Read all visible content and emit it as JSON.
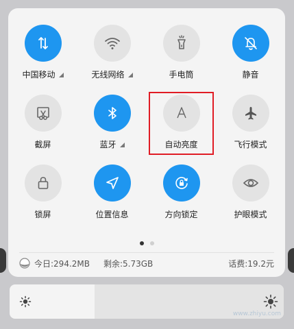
{
  "tiles": [
    {
      "label": "中国移动",
      "icon": "data-transfer-icon",
      "active": true,
      "dropdown": true
    },
    {
      "label": "无线网络",
      "icon": "wifi-icon",
      "active": false,
      "dropdown": true
    },
    {
      "label": "手电筒",
      "icon": "flashlight-icon",
      "active": false,
      "dropdown": false
    },
    {
      "label": "静音",
      "icon": "bell-off-icon",
      "active": true,
      "dropdown": false
    },
    {
      "label": "截屏",
      "icon": "screenshot-icon",
      "active": false,
      "dropdown": false
    },
    {
      "label": "蓝牙",
      "icon": "bluetooth-icon",
      "active": true,
      "dropdown": true
    },
    {
      "label": "自动亮度",
      "icon": "auto-brightness-icon",
      "active": false,
      "dropdown": false
    },
    {
      "label": "飞行模式",
      "icon": "airplane-icon",
      "active": false,
      "dropdown": false
    },
    {
      "label": "锁屏",
      "icon": "lock-icon",
      "active": false,
      "dropdown": false
    },
    {
      "label": "位置信息",
      "icon": "location-icon",
      "active": true,
      "dropdown": false
    },
    {
      "label": "方向锁定",
      "icon": "rotation-lock-icon",
      "active": true,
      "dropdown": false
    },
    {
      "label": "护眼模式",
      "icon": "eye-icon",
      "active": false,
      "dropdown": false
    }
  ],
  "pager": {
    "count": 2,
    "active": 0
  },
  "status": {
    "today": "今日:294.2MB",
    "remaining": "剩余:5.73GB",
    "fee": "话费:19.2元"
  },
  "brightness": {
    "level": 0.31
  },
  "watermark": "www.zhiyu.com",
  "colors": {
    "accent": "#1e96f0",
    "highlight": "#e01b24"
  }
}
